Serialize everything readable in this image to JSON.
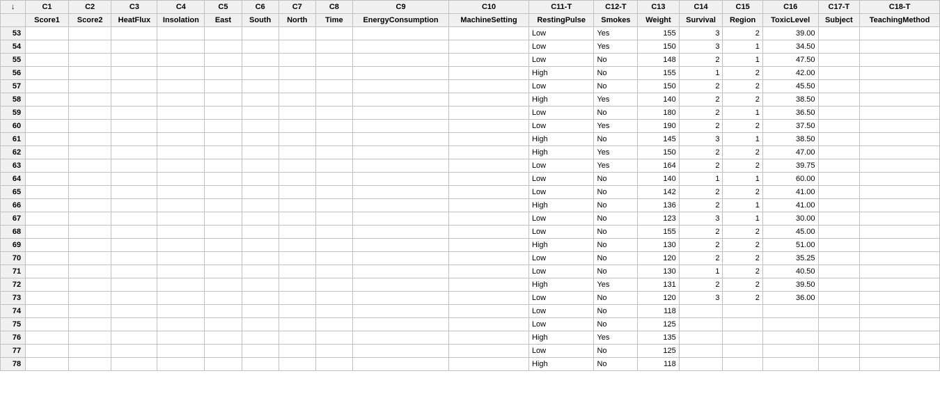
{
  "corner_symbol": "↓",
  "columns": [
    {
      "id": "C1",
      "name": "Score1"
    },
    {
      "id": "C2",
      "name": "Score2"
    },
    {
      "id": "C3",
      "name": "HeatFlux"
    },
    {
      "id": "C4",
      "name": "Insolation"
    },
    {
      "id": "C5",
      "name": "East"
    },
    {
      "id": "C6",
      "name": "South"
    },
    {
      "id": "C7",
      "name": "North"
    },
    {
      "id": "C8",
      "name": "Time"
    },
    {
      "id": "C9",
      "name": "EnergyConsumption"
    },
    {
      "id": "C10",
      "name": "MachineSetting"
    },
    {
      "id": "C11-T",
      "name": "RestingPulse"
    },
    {
      "id": "C12-T",
      "name": "Smokes"
    },
    {
      "id": "C13",
      "name": "Weight"
    },
    {
      "id": "C14",
      "name": "Survival"
    },
    {
      "id": "C15",
      "name": "Region"
    },
    {
      "id": "C16",
      "name": "ToxicLevel"
    },
    {
      "id": "C17-T",
      "name": "Subject"
    },
    {
      "id": "C18-T",
      "name": "TeachingMethod"
    }
  ],
  "rows": [
    {
      "n": 53,
      "RestingPulse": "Low",
      "Smokes": "Yes",
      "Weight": "155",
      "Survival": "3",
      "Region": "2",
      "ToxicLevel": "39.00"
    },
    {
      "n": 54,
      "RestingPulse": "Low",
      "Smokes": "Yes",
      "Weight": "150",
      "Survival": "3",
      "Region": "1",
      "ToxicLevel": "34.50"
    },
    {
      "n": 55,
      "RestingPulse": "Low",
      "Smokes": "No",
      "Weight": "148",
      "Survival": "2",
      "Region": "1",
      "ToxicLevel": "47.50"
    },
    {
      "n": 56,
      "RestingPulse": "High",
      "Smokes": "No",
      "Weight": "155",
      "Survival": "1",
      "Region": "2",
      "ToxicLevel": "42.00"
    },
    {
      "n": 57,
      "RestingPulse": "Low",
      "Smokes": "No",
      "Weight": "150",
      "Survival": "2",
      "Region": "2",
      "ToxicLevel": "45.50"
    },
    {
      "n": 58,
      "RestingPulse": "High",
      "Smokes": "Yes",
      "Weight": "140",
      "Survival": "2",
      "Region": "2",
      "ToxicLevel": "38.50"
    },
    {
      "n": 59,
      "RestingPulse": "Low",
      "Smokes": "No",
      "Weight": "180",
      "Survival": "2",
      "Region": "1",
      "ToxicLevel": "36.50"
    },
    {
      "n": 60,
      "RestingPulse": "Low",
      "Smokes": "Yes",
      "Weight": "190",
      "Survival": "2",
      "Region": "2",
      "ToxicLevel": "37.50"
    },
    {
      "n": 61,
      "RestingPulse": "High",
      "Smokes": "No",
      "Weight": "145",
      "Survival": "3",
      "Region": "1",
      "ToxicLevel": "38.50"
    },
    {
      "n": 62,
      "RestingPulse": "High",
      "Smokes": "Yes",
      "Weight": "150",
      "Survival": "2",
      "Region": "2",
      "ToxicLevel": "47.00"
    },
    {
      "n": 63,
      "RestingPulse": "Low",
      "Smokes": "Yes",
      "Weight": "164",
      "Survival": "2",
      "Region": "2",
      "ToxicLevel": "39.75"
    },
    {
      "n": 64,
      "RestingPulse": "Low",
      "Smokes": "No",
      "Weight": "140",
      "Survival": "1",
      "Region": "1",
      "ToxicLevel": "60.00"
    },
    {
      "n": 65,
      "RestingPulse": "Low",
      "Smokes": "No",
      "Weight": "142",
      "Survival": "2",
      "Region": "2",
      "ToxicLevel": "41.00"
    },
    {
      "n": 66,
      "RestingPulse": "High",
      "Smokes": "No",
      "Weight": "136",
      "Survival": "2",
      "Region": "1",
      "ToxicLevel": "41.00"
    },
    {
      "n": 67,
      "RestingPulse": "Low",
      "Smokes": "No",
      "Weight": "123",
      "Survival": "3",
      "Region": "1",
      "ToxicLevel": "30.00"
    },
    {
      "n": 68,
      "RestingPulse": "Low",
      "Smokes": "No",
      "Weight": "155",
      "Survival": "2",
      "Region": "2",
      "ToxicLevel": "45.00"
    },
    {
      "n": 69,
      "RestingPulse": "High",
      "Smokes": "No",
      "Weight": "130",
      "Survival": "2",
      "Region": "2",
      "ToxicLevel": "51.00"
    },
    {
      "n": 70,
      "RestingPulse": "Low",
      "Smokes": "No",
      "Weight": "120",
      "Survival": "2",
      "Region": "2",
      "ToxicLevel": "35.25"
    },
    {
      "n": 71,
      "RestingPulse": "Low",
      "Smokes": "No",
      "Weight": "130",
      "Survival": "1",
      "Region": "2",
      "ToxicLevel": "40.50"
    },
    {
      "n": 72,
      "RestingPulse": "High",
      "Smokes": "Yes",
      "Weight": "131",
      "Survival": "2",
      "Region": "2",
      "ToxicLevel": "39.50"
    },
    {
      "n": 73,
      "RestingPulse": "Low",
      "Smokes": "No",
      "Weight": "120",
      "Survival": "3",
      "Region": "2",
      "ToxicLevel": "36.00"
    },
    {
      "n": 74,
      "RestingPulse": "Low",
      "Smokes": "No",
      "Weight": "118"
    },
    {
      "n": 75,
      "RestingPulse": "Low",
      "Smokes": "No",
      "Weight": "125"
    },
    {
      "n": 76,
      "RestingPulse": "High",
      "Smokes": "Yes",
      "Weight": "135"
    },
    {
      "n": 77,
      "RestingPulse": "Low",
      "Smokes": "No",
      "Weight": "125"
    },
    {
      "n": 78,
      "RestingPulse": "High",
      "Smokes": "No",
      "Weight": "118"
    }
  ],
  "numeric_columns": [
    "Weight",
    "Survival",
    "Region",
    "ToxicLevel"
  ]
}
